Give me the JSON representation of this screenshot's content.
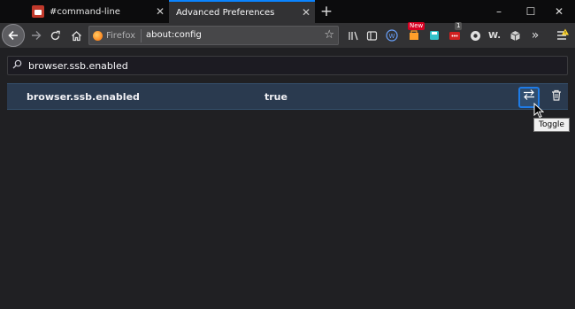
{
  "tabs": [
    {
      "title": "#command-line",
      "active": false
    },
    {
      "title": "Advanced Preferences",
      "active": true
    }
  ],
  "window_controls": {
    "minimize": "–",
    "maximize": "☐",
    "close": "✕"
  },
  "navbar": {
    "identity_label": "Firefox",
    "url": "about:config",
    "badges": {
      "new": "New",
      "count": "1"
    }
  },
  "search": {
    "value": "browser.ssb.enabled"
  },
  "preference": {
    "name": "browser.ssb.enabled",
    "value": "true"
  },
  "tooltip": "Toggle",
  "colors": {
    "accent": "#0a84ff",
    "row_highlight": "#2a3a4f",
    "new_badge": "#d70022"
  }
}
